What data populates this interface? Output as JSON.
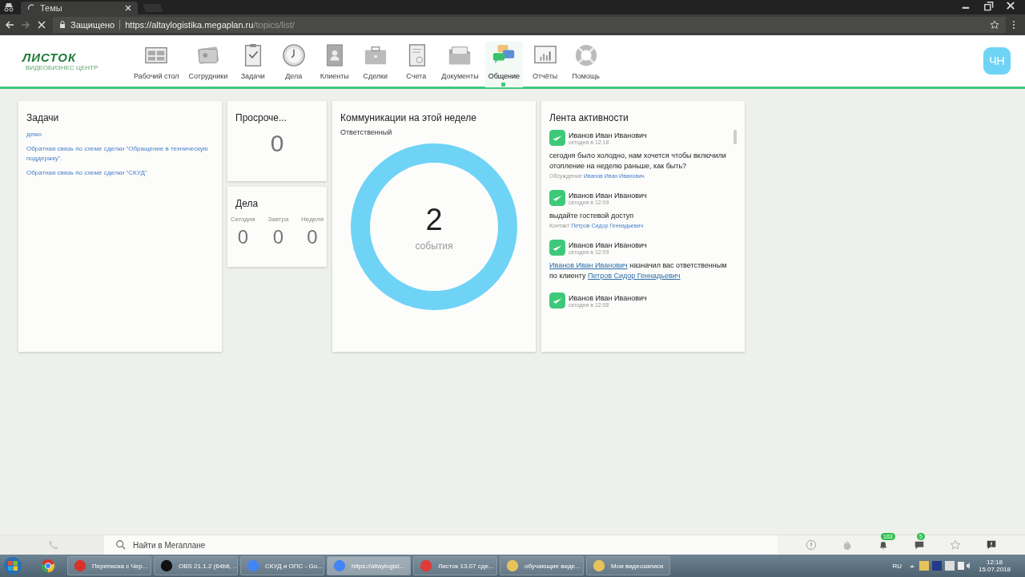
{
  "browser": {
    "tab_title": "Темы",
    "security": "Защищено",
    "url_host": "https://altaylogistika.megaplan.ru",
    "url_path": "/topics/list/"
  },
  "logo": {
    "title": "ЛИСТОК",
    "subtitle": "ВИДЕОБИЗНЕС ЦЕНТР"
  },
  "nav": [
    {
      "label": "Рабочий стол",
      "selected": false
    },
    {
      "label": "Сотрудники",
      "selected": false
    },
    {
      "label": "Задачи",
      "selected": false
    },
    {
      "label": "Дела",
      "selected": false
    },
    {
      "label": "Клиенты",
      "selected": false
    },
    {
      "label": "Сделки",
      "selected": false
    },
    {
      "label": "Счета",
      "selected": false
    },
    {
      "label": "Документы",
      "selected": false
    },
    {
      "label": "Общение",
      "selected": true
    },
    {
      "label": "Отчёты",
      "selected": false
    },
    {
      "label": "Помощь",
      "selected": false
    }
  ],
  "user_avatar": "ЧН",
  "tasks": {
    "title": "Задачи",
    "items": [
      "демо",
      "Обратная связь по схеме сделки \"Обращение в техническую поддержку\".",
      "Обратная связь по схеме сделки \"СКУД\""
    ]
  },
  "overdue": {
    "title": "Просроче...",
    "value": "0"
  },
  "deals": {
    "title": "Дела",
    "columns": [
      {
        "label": "Сегодня",
        "value": "0"
      },
      {
        "label": "Завтра",
        "value": "0"
      },
      {
        "label": "Неделя",
        "value": "0"
      }
    ]
  },
  "communications": {
    "title": "Коммуникации на этой неделе",
    "subtitle": "Ответственный",
    "value": "2",
    "unit": "события"
  },
  "feed": {
    "title": "Лента активности",
    "items": [
      {
        "author": "Иванов Иван Иванович",
        "time": "сегодня в 12:18",
        "parts": [
          {
            "text": "сегодня было холодно, нам хочется чтобы включили отопление на неделю раньше, как быть?",
            "link": false
          }
        ],
        "context": "Обсуждение",
        "context_link": "Иванов Иван Иванович"
      },
      {
        "author": "Иванов Иван Иванович",
        "time": "сегодня в 12:09",
        "parts": [
          {
            "text": "выдайте гостевой доступ",
            "link": false
          }
        ],
        "context": "Контакт",
        "context_link": "Петров Сидор Геннадьевич"
      },
      {
        "author": "Иванов Иван Иванович",
        "time": "сегодня в 12:09",
        "parts": [
          {
            "text": "Иванов Иван Иванович",
            "link": true
          },
          {
            "text": "назначил вас ответственным по клиенту",
            "link": false
          },
          {
            "text": "Петров Сидор Геннадьевич",
            "link": true
          }
        ]
      },
      {
        "author": "Иванов Иван Иванович",
        "time": "сегодня в 12:08"
      }
    ]
  },
  "bottom_bar": {
    "search_placeholder": "Найти в Мегаплане",
    "notifications": "163",
    "messages": "5"
  },
  "taskbar": {
    "items": [
      {
        "label": "Переписка с Чер...",
        "selected": false
      },
      {
        "label": "OBS 21.1.2 (64bit, ...",
        "selected": false
      },
      {
        "label": "СКУД и ОПС - Go...",
        "selected": false
      },
      {
        "label": "https://altaylogist...",
        "selected": true
      },
      {
        "label": "Листок 13.07 сде...",
        "selected": false
      },
      {
        "label": "обучающие виде...",
        "selected": false
      },
      {
        "label": "Мои видеозаписи",
        "selected": false
      }
    ],
    "language": "RU",
    "time": "12:18",
    "date": "15.07.2018"
  }
}
